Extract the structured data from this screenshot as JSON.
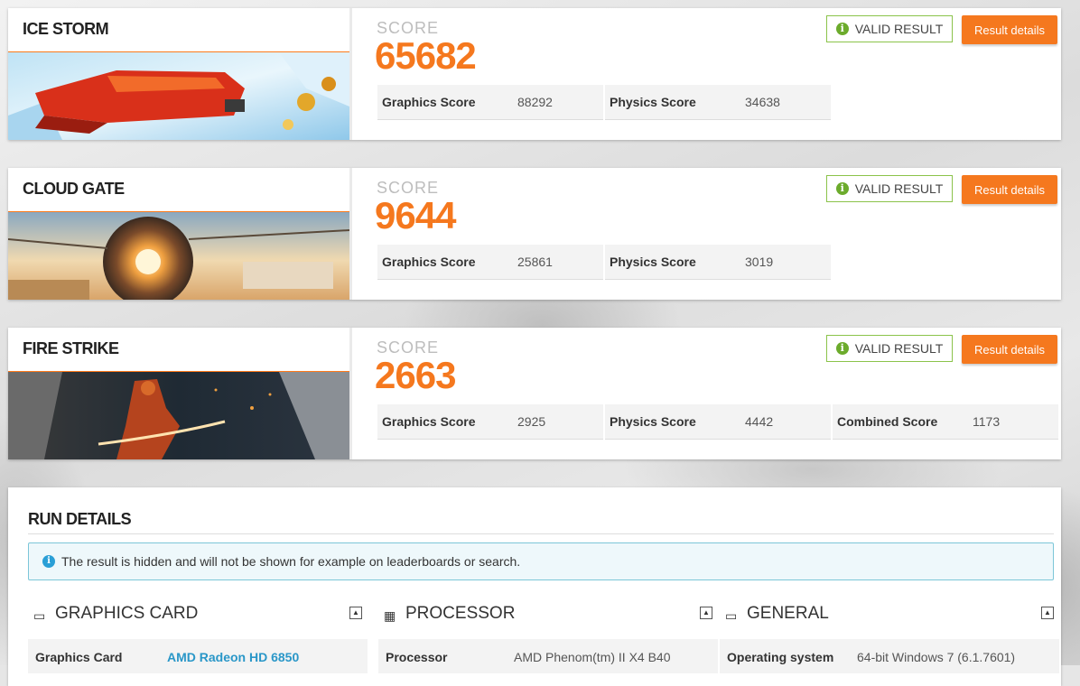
{
  "benchmarks": [
    {
      "name": "ICE STORM",
      "score_label": "SCORE",
      "score": "65682",
      "valid_label": "VALID RESULT",
      "details_label": "Result details",
      "subscores": [
        {
          "label": "Graphics Score",
          "value": "88292"
        },
        {
          "label": "Physics Score",
          "value": "34638"
        }
      ]
    },
    {
      "name": "CLOUD GATE",
      "score_label": "SCORE",
      "score": "9644",
      "valid_label": "VALID RESULT",
      "details_label": "Result details",
      "subscores": [
        {
          "label": "Graphics Score",
          "value": "25861"
        },
        {
          "label": "Physics Score",
          "value": "3019"
        }
      ]
    },
    {
      "name": "FIRE STRIKE",
      "score_label": "SCORE",
      "score": "2663",
      "valid_label": "VALID RESULT",
      "details_label": "Result details",
      "subscores": [
        {
          "label": "Graphics Score",
          "value": "2925"
        },
        {
          "label": "Physics Score",
          "value": "4442"
        },
        {
          "label": "Combined Score",
          "value": "1173"
        }
      ]
    }
  ],
  "run_details": {
    "title": "RUN DETAILS",
    "notice": "The result is hidden and will not be shown for example on leaderboards or search.",
    "sections": [
      {
        "title": "GRAPHICS CARD",
        "icon": "monitor-icon",
        "row_label": "Graphics Card",
        "row_value": "AMD Radeon HD 6850"
      },
      {
        "title": "PROCESSOR",
        "icon": "chip-icon",
        "row_label": "Processor",
        "row_value": "AMD Phenom(tm) II X4 B40"
      },
      {
        "title": "GENERAL",
        "icon": "laptop-icon",
        "row_label": "Operating system",
        "row_value": "64-bit Windows 7 (6.1.7601)"
      }
    ]
  },
  "colors": {
    "accent": "#f5781e",
    "valid_border": "#8bc34a",
    "valid_icon": "#6cab2c",
    "info": "#2a9fd6",
    "link": "#2a97c8"
  }
}
